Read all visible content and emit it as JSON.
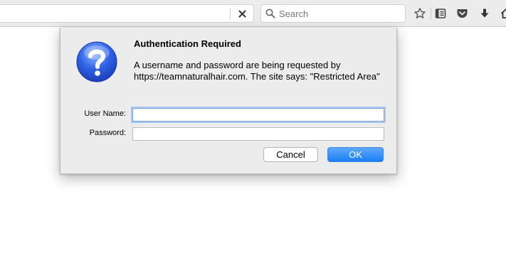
{
  "browser": {
    "urlbar": {
      "value": "",
      "stop_icon": "close-icon"
    },
    "search": {
      "placeholder": "Search",
      "icon": "search-icon"
    },
    "toolbar_icons": [
      "bookmark-star-icon",
      "reading-list-icon",
      "pocket-icon",
      "download-icon",
      "home-icon"
    ]
  },
  "dialog": {
    "title": "Authentication Required",
    "message": "A username and password are being requested by https://teamnaturalhair.com. The site says: \"Restricted Area\"",
    "username_label": "User Name:",
    "username_value": "",
    "password_label": "Password:",
    "password_value": "",
    "cancel_label": "Cancel",
    "ok_label": "OK",
    "icon": "question-icon"
  },
  "colors": {
    "ok_button": "#1a7ff5",
    "dialog_bg": "#ececec",
    "toolbar_bg": "#ececec",
    "focus_ring": "#a9c8ee"
  }
}
